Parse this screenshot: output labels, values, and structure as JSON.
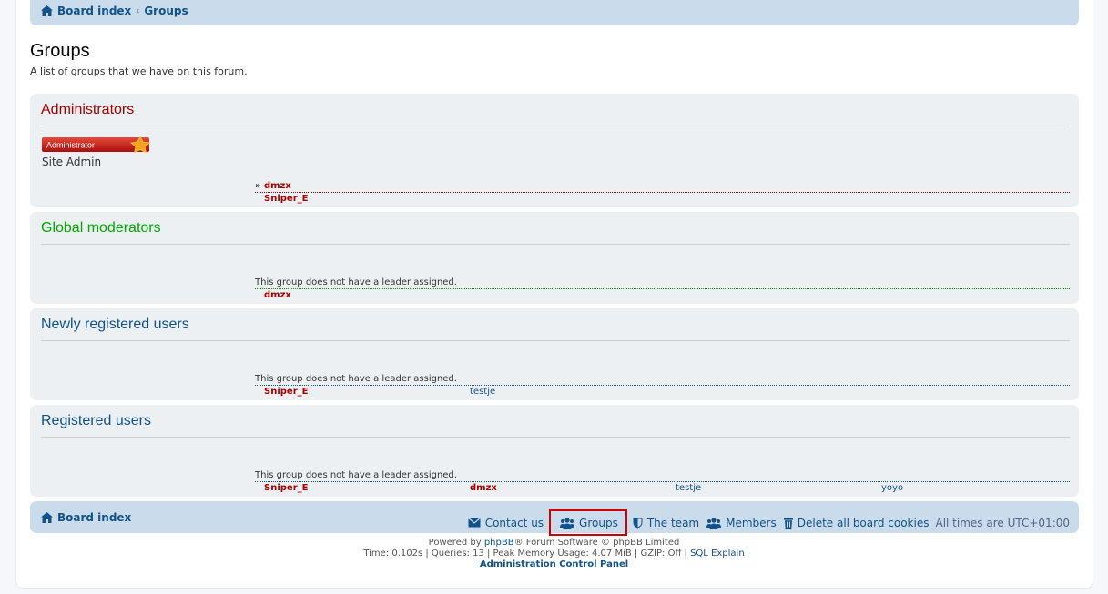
{
  "breadcrumb": {
    "home": "Board index",
    "current": "Groups"
  },
  "page": {
    "title": "Groups",
    "description": "A list of groups that we have on this forum."
  },
  "groups": [
    {
      "name": "Administrators",
      "color": "#aa0000",
      "rank_image_text": "Administrator",
      "rank_title": "Site Admin",
      "leader": "dmzx",
      "leader_prefix": "»",
      "members": [
        "Sniper_E"
      ]
    },
    {
      "name": "Global moderators",
      "color": "#00aa00",
      "no_leader_text": "This group does not have a leader assigned.",
      "members": [
        "dmzx"
      ]
    },
    {
      "name": "Newly registered users",
      "color": "#105289",
      "no_leader_text": "This group does not have a leader assigned.",
      "members": [
        "Sniper_E",
        "testje"
      ]
    },
    {
      "name": "Registered users",
      "color": "#105289",
      "no_leader_text": "This group does not have a leader assigned.",
      "members": [
        "Sniper_E",
        "dmzx",
        "testje",
        "yoyo"
      ]
    }
  ],
  "footer_nav": {
    "home": "Board index",
    "contact": "Contact us",
    "groups": "Groups",
    "team": "The team",
    "members": "Members",
    "delete_cookies": "Delete all board cookies",
    "timezone": "All times are UTC+01:00"
  },
  "copyright": {
    "powered_prefix": "Powered by",
    "phpbb": "phpBB",
    "powered_suffix": "® Forum Software © phpBB Limited",
    "stats": "Time: 0.102s | Queries: 13 | Peak Memory Usage: 4.07 MiB | GZIP: Off |",
    "sql_explain": "SQL Explain",
    "acp": "Administration Control Panel"
  },
  "colors": {
    "accent": "#105289",
    "navbar": "#cadceb",
    "panel": "#ecf0f3",
    "highlight_box": "#d00000"
  }
}
